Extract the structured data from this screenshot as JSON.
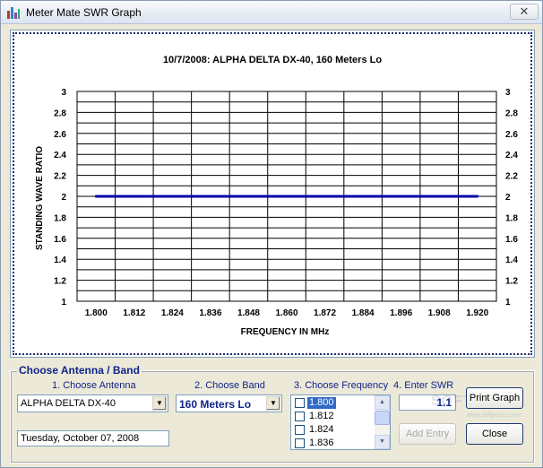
{
  "window": {
    "title": "Meter Mate SWR Graph",
    "close_glyph": "✕",
    "app_icon": "bar-chart-icon"
  },
  "chart_data": {
    "type": "line",
    "title": "10/7/2008: ALPHA DELTA DX-40, 160 Meters Lo",
    "xlabel": "FREQUENCY IN MHz",
    "ylabel": "STANDING WAVE RATIO",
    "categories": [
      "1.800",
      "1.812",
      "1.824",
      "1.836",
      "1.848",
      "1.860",
      "1.872",
      "1.884",
      "1.896",
      "1.908",
      "1.920"
    ],
    "y_ticks": [
      "3",
      "2.8",
      "2.6",
      "2.4",
      "2.2",
      "2",
      "1.8",
      "1.6",
      "1.4",
      "1.2",
      "1"
    ],
    "ylim": [
      1,
      3
    ],
    "series": [
      {
        "values": [
          2,
          2,
          2,
          2,
          2,
          2,
          2,
          2,
          2,
          2,
          2
        ],
        "color": "#0000aa"
      }
    ],
    "grid": true
  },
  "panel": {
    "group_label": "Choose Antenna / Band",
    "step1_label": "1. Choose Antenna",
    "step2_label": "2. Choose Band",
    "step3_label": "3. Choose Frequency",
    "step4_label": "4. Enter SWR",
    "antenna_value": "ALPHA DELTA DX-40",
    "band_value": "160 Meters Lo",
    "date_value": "Tuesday, October 07, 2008",
    "frequencies": [
      "1.800",
      "1.812",
      "1.824",
      "1.836"
    ],
    "selected_frequency": "1.800",
    "swr_value": "1.1",
    "print_graph_label": "Print Graph",
    "add_entry_label": "Add Entry",
    "close_label": "Close"
  },
  "watermark": {
    "text": "SOFTPEDIA",
    "sub": "www.softpedia.com"
  },
  "colors": {
    "accent": "#10248a",
    "series": "#0000aa",
    "selection": "#316ac5"
  }
}
